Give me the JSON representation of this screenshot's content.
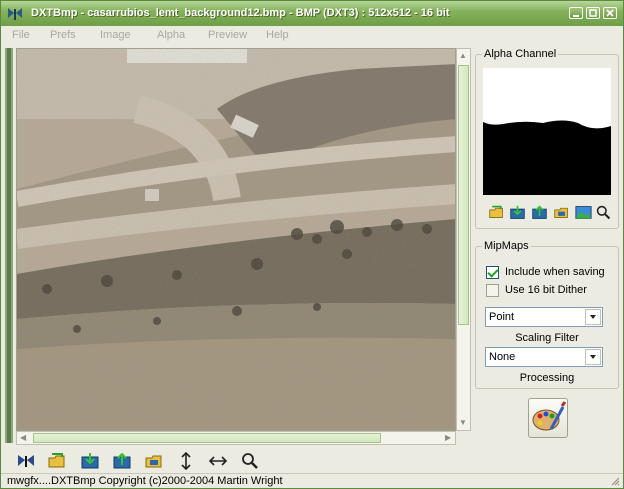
{
  "window": {
    "title": "DXTBmp - casarrubios_lemt_background12.bmp - BMP (DXT3) : 512x512 - 16 bit"
  },
  "menu": {
    "items": [
      "File",
      "Prefs",
      "Image",
      "Alpha",
      "Preview",
      "Help"
    ]
  },
  "alpha_channel": {
    "title": "Alpha Channel",
    "tools": [
      "open-folder-icon",
      "export-icon",
      "import-icon",
      "folder-image-icon",
      "landscape-icon",
      "zoom-icon"
    ]
  },
  "mipmaps": {
    "title": "MipMaps",
    "include_when_saving": {
      "label": "Include when saving",
      "checked": true
    },
    "use_16bit_dither": {
      "label": "Use 16 bit Dither",
      "checked": false
    },
    "scaling_filter": {
      "value": "Point",
      "caption": "Scaling Filter"
    },
    "processing": {
      "value": "None",
      "caption": "Processing"
    }
  },
  "toolbar": {
    "tools": [
      "butterfly-icon",
      "open-folder-icon",
      "export-icon",
      "import-icon",
      "folder-image-icon",
      "vertical-arrows-icon",
      "horizontal-arrows-icon",
      "zoom-icon"
    ]
  },
  "status": {
    "text": "mwgfx....DXTBmp Copyright (c)2000-2004 Martin Wright"
  },
  "colors": {
    "titlebar": "#6e9e45",
    "window_bg": "#ebebe1",
    "scroll_thumb": "#d2e7bd"
  }
}
